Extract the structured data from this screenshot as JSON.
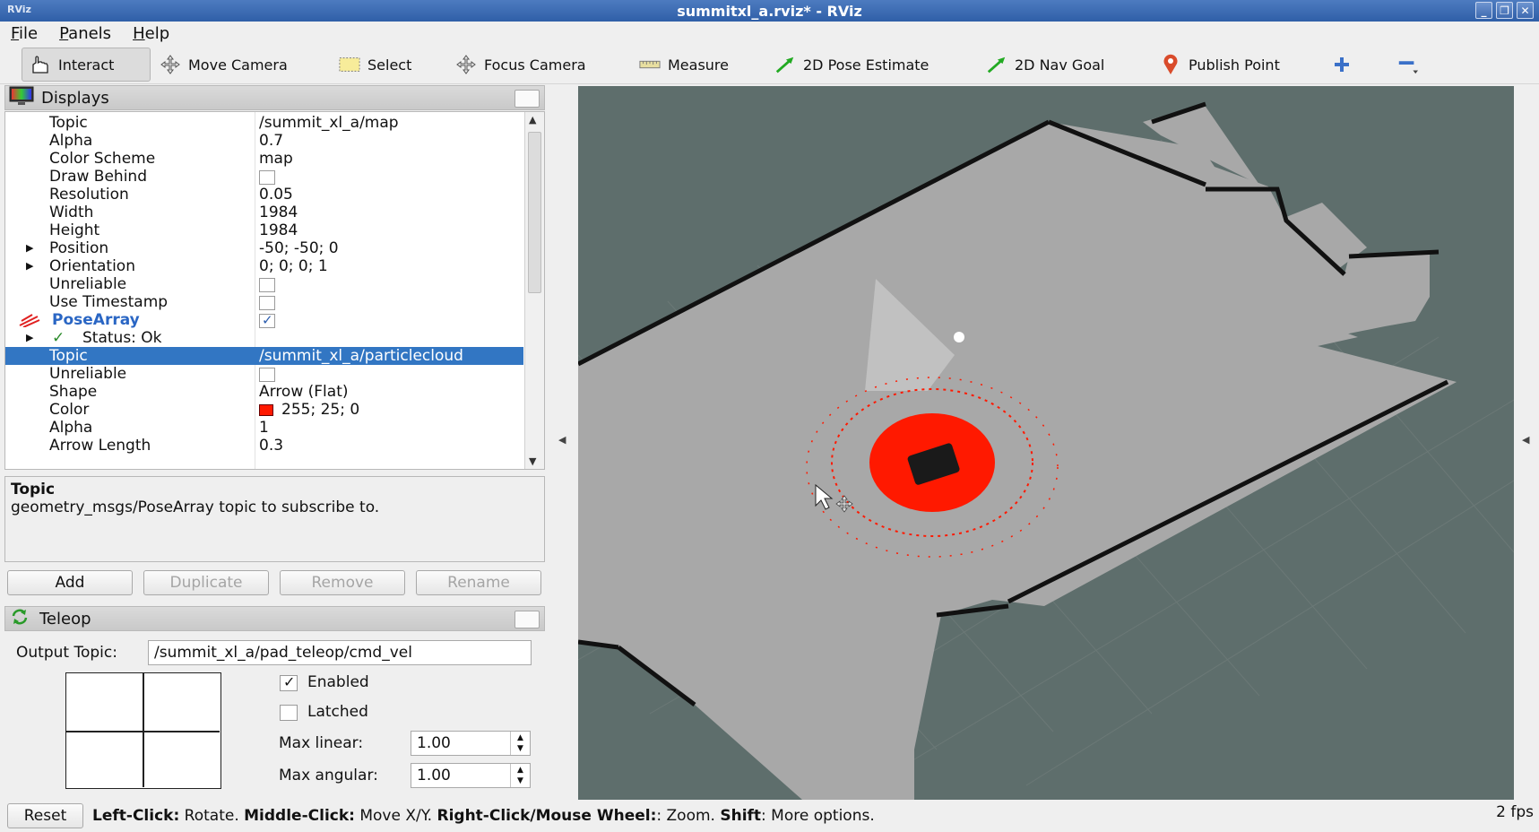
{
  "window": {
    "title": "summitxl_a.rviz* - RViz",
    "sys_label": "RViz"
  },
  "menu": [
    "File",
    "Panels",
    "Help"
  ],
  "toolbar": {
    "interact": "Interact",
    "move_camera": "Move Camera",
    "select": "Select",
    "focus_camera": "Focus Camera",
    "measure": "Measure",
    "pose_estimate": "2D Pose Estimate",
    "nav_goal": "2D Nav Goal",
    "publish_point": "Publish Point"
  },
  "displays": {
    "title": "Displays",
    "rows": [
      {
        "key": "Topic",
        "value": "/summit_xl_a/map"
      },
      {
        "key": "Alpha",
        "value": "0.7"
      },
      {
        "key": "Color Scheme",
        "value": "map"
      },
      {
        "key": "Draw Behind",
        "value": ""
      },
      {
        "key": "Resolution",
        "value": "0.05"
      },
      {
        "key": "Width",
        "value": "1984"
      },
      {
        "key": "Height",
        "value": "1984"
      },
      {
        "key": "Position",
        "value": "-50; -50; 0"
      },
      {
        "key": "Orientation",
        "value": "0; 0; 0; 1"
      },
      {
        "key": "Unreliable",
        "value": ""
      },
      {
        "key": "Use Timestamp",
        "value": ""
      },
      {
        "key": "PoseArray",
        "value": ""
      },
      {
        "key": "Status: Ok",
        "value": ""
      },
      {
        "key": "Topic",
        "value": "/summit_xl_a/particlecloud"
      },
      {
        "key": "Unreliable",
        "value": ""
      },
      {
        "key": "Shape",
        "value": "Arrow (Flat)"
      },
      {
        "key": "Color",
        "value": "255; 25; 0"
      },
      {
        "key": "Alpha",
        "value": "1"
      },
      {
        "key": "Arrow Length",
        "value": "0.3"
      }
    ],
    "pose_color": "#ff1900"
  },
  "description": {
    "title": "Topic",
    "text": "geometry_msgs/PoseArray topic to subscribe to."
  },
  "buttons": {
    "add": "Add",
    "duplicate": "Duplicate",
    "remove": "Remove",
    "rename": "Rename"
  },
  "teleop": {
    "title": "Teleop",
    "output_label": "Output Topic:",
    "output_value": "/summit_xl_a/pad_teleop/cmd_vel",
    "enabled": "Enabled",
    "latched": "Latched",
    "max_linear_label": "Max linear:",
    "max_linear": "1.00",
    "max_angular_label": "Max angular:",
    "max_angular": "1.00"
  },
  "status": {
    "reset": "Reset",
    "h1": "Left-Click:",
    "t1": " Rotate. ",
    "h2": "Middle-Click:",
    "t2": " Move X/Y. ",
    "h3": "Right-Click/Mouse Wheel:",
    "t3": ": Zoom. ",
    "h4": "Shift",
    "t4": ": More options.",
    "fps": "2 fps"
  }
}
